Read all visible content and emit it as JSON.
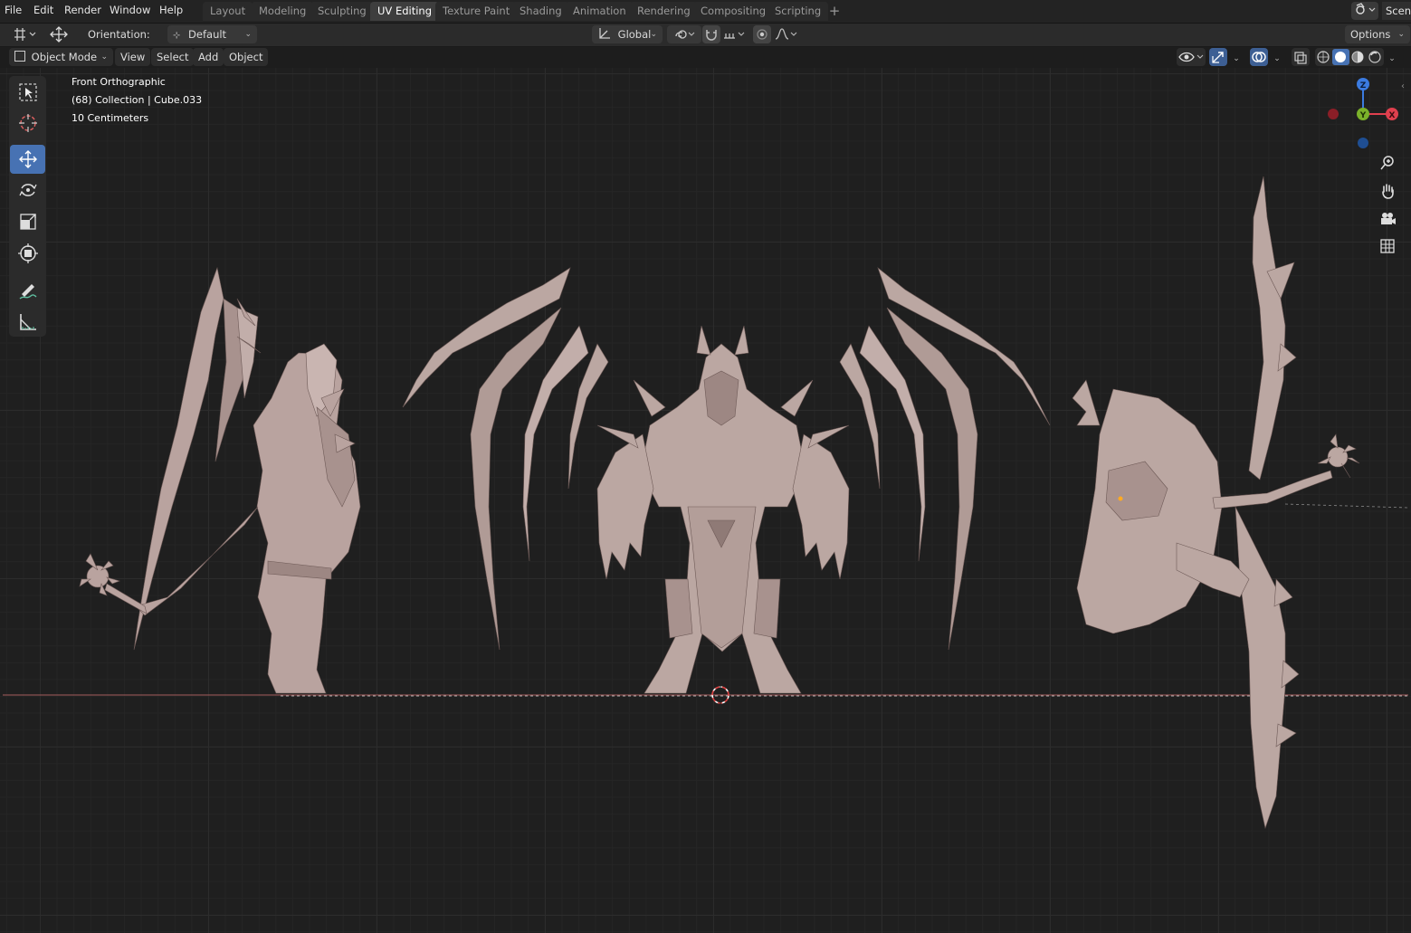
{
  "menu": [
    "File",
    "Edit",
    "Render",
    "Window",
    "Help"
  ],
  "workspaces": [
    {
      "label": "Layout",
      "active": false
    },
    {
      "label": "Modeling",
      "active": false
    },
    {
      "label": "Sculpting",
      "active": false
    },
    {
      "label": "UV Editing",
      "active": true
    },
    {
      "label": "Texture Paint",
      "active": false
    },
    {
      "label": "Shading",
      "active": false
    },
    {
      "label": "Animation",
      "active": false
    },
    {
      "label": "Rendering",
      "active": false
    },
    {
      "label": "Compositing",
      "active": false
    },
    {
      "label": "Scripting",
      "active": false
    }
  ],
  "workspace_add": "+",
  "scene": {
    "name": "Scene"
  },
  "tool_settings": {
    "orientation_label": "Orientation:",
    "orientation_value": "Default",
    "transform_orientation": "Global",
    "options_label": "Options"
  },
  "header": {
    "mode": "Object Mode",
    "menus": [
      "View",
      "Select",
      "Add",
      "Object"
    ]
  },
  "viewport": {
    "view_name": "Front Orthographic",
    "collection_info": "(68) Collection | Cube.033",
    "scale_info": "10 Centimeters",
    "mesh_color": "#bba7a2"
  },
  "gizmo": {
    "z": "Z",
    "y": "Y",
    "x": "X"
  },
  "tools": [
    "select-box",
    "cursor",
    "move",
    "rotate",
    "scale",
    "transform",
    "annotate",
    "measure"
  ]
}
